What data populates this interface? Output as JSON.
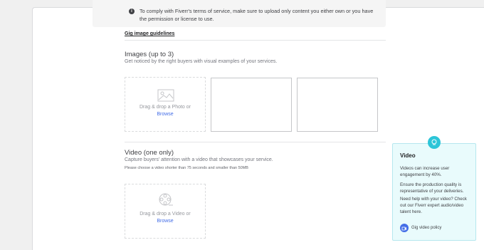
{
  "notice": {
    "text": "To comply with Fiverr's terms of service, make sure to upload only content you either own or you have the permission or license to use."
  },
  "guidelines_link": "Gig image guidelines",
  "images_section": {
    "title": "Images (up to 3)",
    "subtitle": "Get noticed by the right buyers with visual examples of your services.",
    "drop_text": "Drag & drop a Photo or",
    "browse": "Browse"
  },
  "video_section": {
    "title": "Video (one only)",
    "subtitle": "Capture buyers' attention with a video that showcases your service.",
    "note": "Please choose a video shorter than 75 seconds and smaller than 50MB",
    "drop_text": "Drag & drop a Video or",
    "browse": "Browse"
  },
  "tooltip": {
    "title": "Video",
    "para1": "Videos can increase user engagement by 40%.",
    "para2": "Ensure the production quality is representative of your deliveries.",
    "para3": "Need help with your video? Check out our Fiverr expert audio/video talent here.",
    "link": "Gig video policy"
  },
  "colors": {
    "accent": "#446ee7",
    "tooltip_bg": "#e9fbfc",
    "bulb": "#2cc5d8"
  }
}
